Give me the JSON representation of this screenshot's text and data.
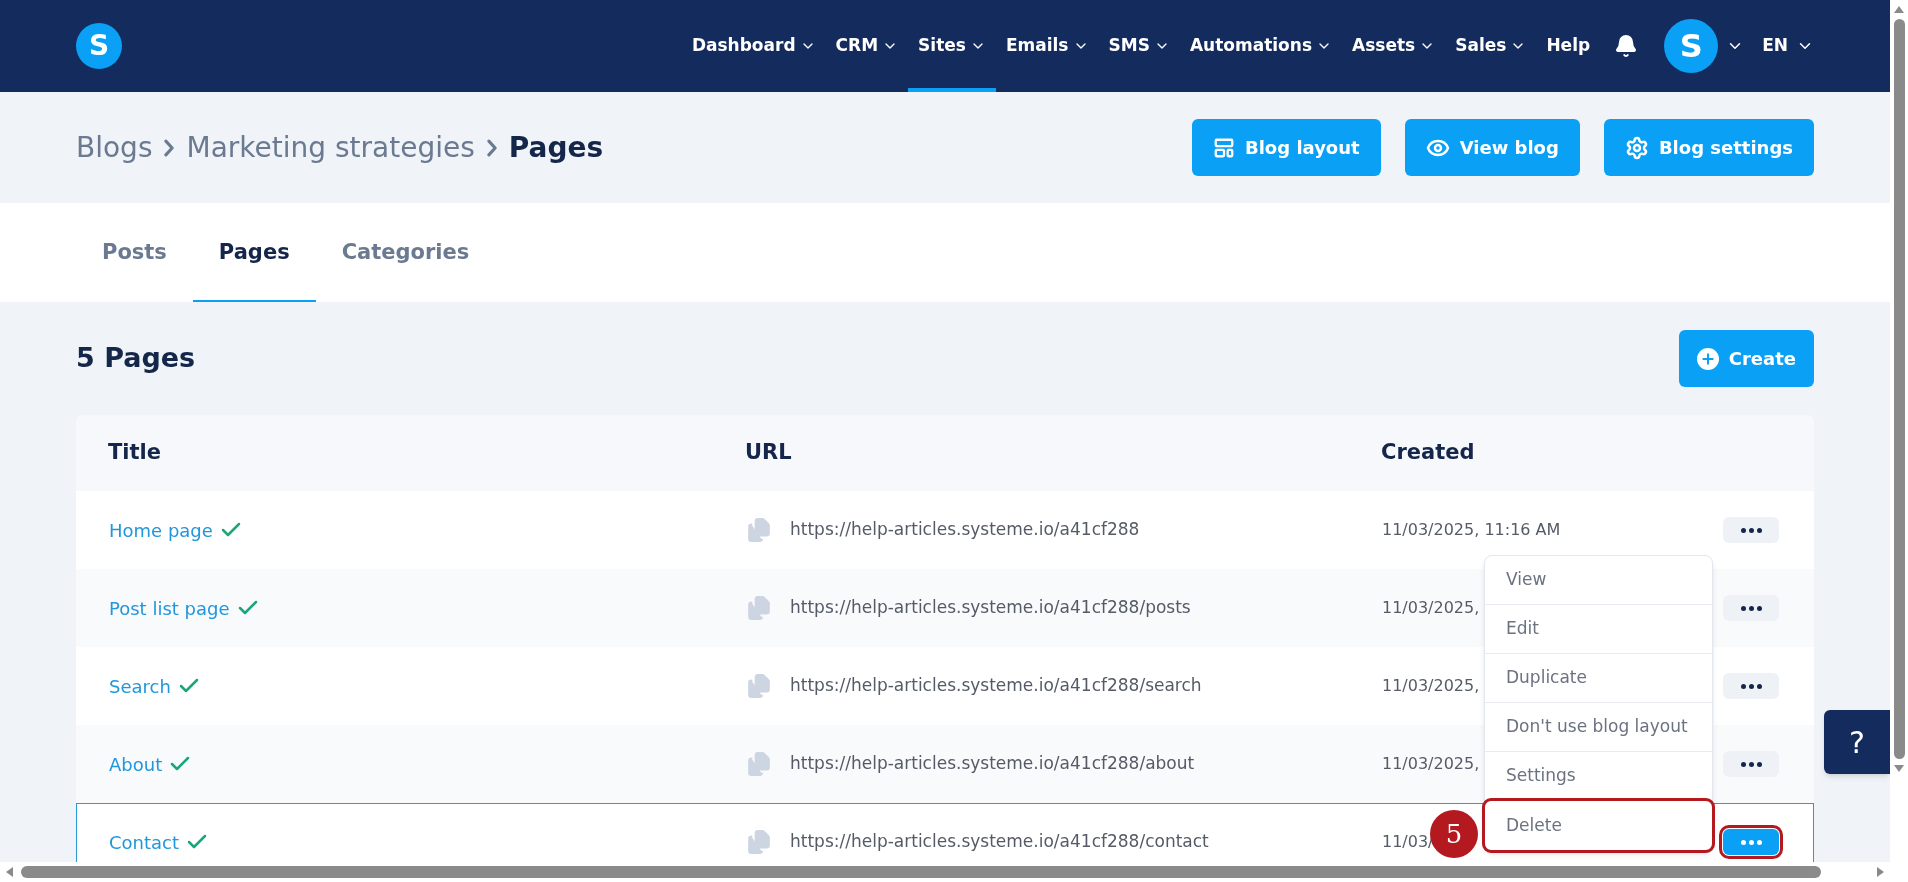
{
  "nav": {
    "logo": "S",
    "items": [
      {
        "label": "Dashboard",
        "dropdown": true,
        "selected": false
      },
      {
        "label": "CRM",
        "dropdown": true,
        "selected": false
      },
      {
        "label": "Sites",
        "dropdown": true,
        "selected": true
      },
      {
        "label": "Emails",
        "dropdown": true,
        "selected": false
      },
      {
        "label": "SMS",
        "dropdown": true,
        "selected": false
      },
      {
        "label": "Automations",
        "dropdown": true,
        "selected": false
      },
      {
        "label": "Assets",
        "dropdown": true,
        "selected": false
      },
      {
        "label": "Sales",
        "dropdown": true,
        "selected": false
      },
      {
        "label": "Help",
        "dropdown": false,
        "selected": false
      }
    ],
    "avatar": "S",
    "language": "EN"
  },
  "breadcrumb": [
    "Blogs",
    "Marketing strategies",
    "Pages"
  ],
  "header_buttons": [
    {
      "kind": "layout",
      "label": "Blog layout"
    },
    {
      "kind": "view",
      "label": "View blog"
    },
    {
      "kind": "settings",
      "label": "Blog settings"
    }
  ],
  "tabs": [
    {
      "label": "Posts",
      "selected": false
    },
    {
      "label": "Pages",
      "selected": true
    },
    {
      "label": "Categories",
      "selected": false
    }
  ],
  "heading": "5 Pages",
  "create_button": "Create",
  "table": {
    "columns": [
      "Title",
      "URL",
      "Created"
    ],
    "rows": [
      {
        "title": "Home page",
        "url": "https://help-articles.systeme.io/a41cf288",
        "created": "11/03/2025, 11:16 AM",
        "selected": false
      },
      {
        "title": "Post list page",
        "url": "https://help-articles.systeme.io/a41cf288/posts",
        "created": "11/03/2025,",
        "selected": false
      },
      {
        "title": "Search",
        "url": "https://help-articles.systeme.io/a41cf288/search",
        "created": "11/03/2025,",
        "selected": false
      },
      {
        "title": "About",
        "url": "https://help-articles.systeme.io/a41cf288/about",
        "created": "11/03/2025,",
        "selected": false
      },
      {
        "title": "Contact",
        "url": "https://help-articles.systeme.io/a41cf288/contact",
        "created": "11/03/",
        "selected": true
      }
    ]
  },
  "menu": [
    {
      "label": "View",
      "highlighted": false
    },
    {
      "label": "Edit",
      "highlighted": false
    },
    {
      "label": "Duplicate",
      "highlighted": false
    },
    {
      "label": "Don't use blog layout",
      "highlighted": false
    },
    {
      "label": "Settings",
      "highlighted": false
    },
    {
      "label": "Delete",
      "highlighted": true
    }
  ],
  "step_badge": "5",
  "help_button": "?"
}
